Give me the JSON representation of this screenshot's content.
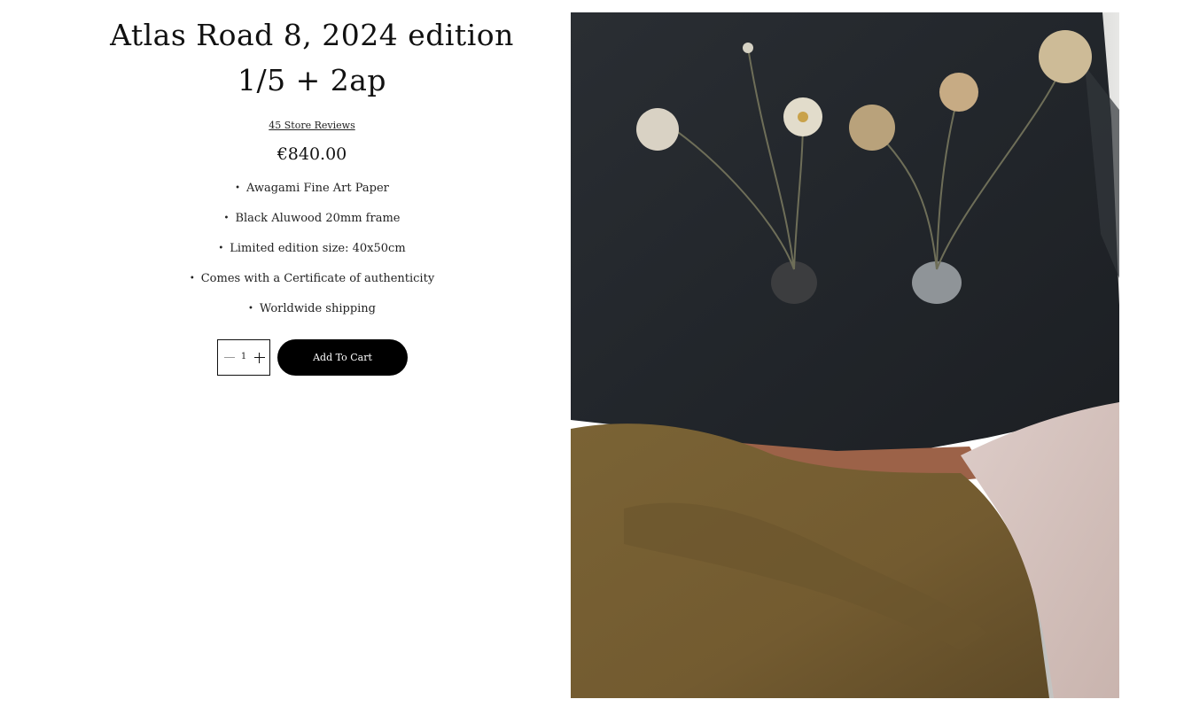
{
  "product": {
    "title_line1": "Atlas Road 8, 2024 edition",
    "title_line2": "1/5 + 2ap",
    "reviews_link": "45 Store Reviews",
    "price": "€840.00",
    "features": [
      "Awagami Fine Art Paper",
      "Black Aluwood 20mm frame",
      "Limited edition size: 40x50cm",
      "Comes with a Certificate of authenticity",
      "Worldwide shipping"
    ],
    "bullet": "•"
  },
  "cart": {
    "quantity": "1",
    "add_to_cart_label": "Add To Cart"
  },
  "icons": {
    "minus": "minus-icon",
    "plus": "plus-icon"
  },
  "colors": {
    "button_bg": "#000000",
    "button_text": "#ffffff",
    "text": "#111111",
    "blanket": "#23262b",
    "duvet": "#7b6436",
    "pink_sheet": "#d8c6c2",
    "stripe": "#9c6248"
  }
}
